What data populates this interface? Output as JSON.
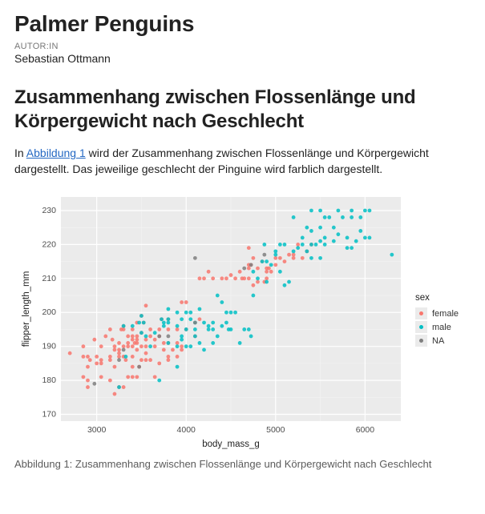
{
  "header": {
    "title": "Palmer Penguins",
    "author_label": "AUTOR:IN",
    "author_name": "Sebastian Ottmann"
  },
  "section": {
    "heading": "Zusammenhang zwischen Flossenlänge und Körpergewicht nach Geschlecht",
    "para_before": "In ",
    "figref": "Abbildung 1",
    "para_after": " wird der Zusammenhang zwischen Flossenlänge und Körpergewicht dargestellt. Das jeweilige geschlecht der Pinguine wird farblich dargestellt."
  },
  "figure": {
    "caption": "Abbildung 1: Zusammenhang zwischen Flossenlänge und Körpergewicht nach Geschlecht"
  },
  "colors": {
    "female": "#f8766d",
    "male": "#00bfc4",
    "na": "#7f7f7f",
    "panel": "#ebebeb"
  },
  "legend": {
    "title": "sex",
    "items": [
      {
        "label": "female",
        "color_key": "female"
      },
      {
        "label": "male",
        "color_key": "male"
      },
      {
        "label": "NA",
        "color_key": "na"
      }
    ]
  },
  "chart_data": {
    "type": "scatter",
    "xlabel": "body_mass_g",
    "ylabel": "flipper_length_mm",
    "xlim": [
      2600,
      6400
    ],
    "ylim": [
      168,
      234
    ],
    "x_ticks": [
      3000,
      4000,
      5000,
      6000
    ],
    "y_ticks": [
      170,
      180,
      190,
      200,
      210,
      220,
      230
    ],
    "series": [
      {
        "name": "female",
        "color_key": "female",
        "points": [
          [
            2700,
            188
          ],
          [
            2850,
            181
          ],
          [
            2850,
            187
          ],
          [
            2850,
            190
          ],
          [
            2900,
            178
          ],
          [
            2900,
            180
          ],
          [
            2900,
            184
          ],
          [
            2900,
            187
          ],
          [
            2925,
            186
          ],
          [
            2975,
            192
          ],
          [
            3000,
            185
          ],
          [
            3000,
            187
          ],
          [
            3050,
            181
          ],
          [
            3050,
            185
          ],
          [
            3050,
            186
          ],
          [
            3050,
            190
          ],
          [
            3100,
            193
          ],
          [
            3150,
            180
          ],
          [
            3150,
            186
          ],
          [
            3150,
            187
          ],
          [
            3150,
            195
          ],
          [
            3175,
            192
          ],
          [
            3200,
            176
          ],
          [
            3200,
            184
          ],
          [
            3200,
            189
          ],
          [
            3200,
            190
          ],
          [
            3250,
            178
          ],
          [
            3250,
            187
          ],
          [
            3250,
            188
          ],
          [
            3250,
            189
          ],
          [
            3250,
            191
          ],
          [
            3275,
            195
          ],
          [
            3300,
            178
          ],
          [
            3300,
            187
          ],
          [
            3300,
            190
          ],
          [
            3300,
            195
          ],
          [
            3300,
            196
          ],
          [
            3325,
            186
          ],
          [
            3350,
            181
          ],
          [
            3350,
            190
          ],
          [
            3350,
            191
          ],
          [
            3350,
            193
          ],
          [
            3400,
            181
          ],
          [
            3400,
            184
          ],
          [
            3400,
            187
          ],
          [
            3400,
            190
          ],
          [
            3400,
            192
          ],
          [
            3400,
            193
          ],
          [
            3400,
            195
          ],
          [
            3425,
            191
          ],
          [
            3450,
            181
          ],
          [
            3450,
            189
          ],
          [
            3450,
            191
          ],
          [
            3450,
            192
          ],
          [
            3450,
            193
          ],
          [
            3450,
            197
          ],
          [
            3475,
            184
          ],
          [
            3500,
            186
          ],
          [
            3500,
            190
          ],
          [
            3500,
            194
          ],
          [
            3500,
            199
          ],
          [
            3525,
            197
          ],
          [
            3550,
            186
          ],
          [
            3550,
            188
          ],
          [
            3550,
            190
          ],
          [
            3550,
            192
          ],
          [
            3550,
            202
          ],
          [
            3600,
            186
          ],
          [
            3600,
            193
          ],
          [
            3600,
            195
          ],
          [
            3650,
            181
          ],
          [
            3650,
            190
          ],
          [
            3650,
            192
          ],
          [
            3700,
            185
          ],
          [
            3700,
            193
          ],
          [
            3700,
            195
          ],
          [
            3725,
            198
          ],
          [
            3750,
            189
          ],
          [
            3750,
            191
          ],
          [
            3800,
            186
          ],
          [
            3800,
            187
          ],
          [
            3800,
            191
          ],
          [
            3800,
            195
          ],
          [
            3800,
            198
          ],
          [
            3850,
            189
          ],
          [
            3900,
            187
          ],
          [
            3900,
            191
          ],
          [
            3900,
            195
          ],
          [
            3950,
            189
          ],
          [
            3950,
            190
          ],
          [
            4000,
            195
          ],
          [
            4000,
            203
          ],
          [
            4100,
            193
          ],
          [
            4150,
            210
          ],
          [
            4150,
            198
          ],
          [
            3950,
            203
          ],
          [
            4200,
            210
          ],
          [
            4250,
            212
          ],
          [
            4300,
            210
          ],
          [
            4400,
            210
          ],
          [
            4450,
            210
          ],
          [
            4500,
            211
          ],
          [
            4550,
            210
          ],
          [
            4600,
            212
          ],
          [
            4625,
            210
          ],
          [
            4650,
            210
          ],
          [
            4700,
            210
          ],
          [
            4700,
            213
          ],
          [
            4700,
            214
          ],
          [
            4700,
            219
          ],
          [
            4725,
            214
          ],
          [
            4750,
            208
          ],
          [
            4750,
            216
          ],
          [
            4800,
            209
          ],
          [
            4800,
            213
          ],
          [
            4850,
            215
          ],
          [
            4875,
            209
          ],
          [
            4900,
            210
          ],
          [
            4900,
            212
          ],
          [
            4900,
            213
          ],
          [
            4925,
            213
          ],
          [
            4950,
            212
          ],
          [
            5000,
            214
          ],
          [
            5000,
            216
          ],
          [
            5050,
            216
          ],
          [
            5100,
            215
          ],
          [
            5150,
            217
          ],
          [
            5200,
            216
          ],
          [
            5200,
            217
          ],
          [
            5250,
            220
          ],
          [
            5300,
            216
          ],
          [
            5350,
            218
          ],
          [
            5400,
            220
          ]
        ]
      },
      {
        "name": "male",
        "color_key": "male",
        "points": [
          [
            3250,
            178
          ],
          [
            3300,
            196
          ],
          [
            3325,
            187
          ],
          [
            3400,
            196
          ],
          [
            3475,
            197
          ],
          [
            3500,
            194
          ],
          [
            3500,
            199
          ],
          [
            3525,
            197
          ],
          [
            3550,
            193
          ],
          [
            3600,
            190
          ],
          [
            3650,
            194
          ],
          [
            3700,
            180
          ],
          [
            3725,
            198
          ],
          [
            3750,
            196
          ],
          [
            3750,
            197
          ],
          [
            3800,
            191
          ],
          [
            3800,
            197
          ],
          [
            3800,
            198
          ],
          [
            3800,
            201
          ],
          [
            3900,
            184
          ],
          [
            3900,
            190
          ],
          [
            3900,
            196
          ],
          [
            3900,
            200
          ],
          [
            3950,
            192
          ],
          [
            3950,
            193
          ],
          [
            3950,
            198
          ],
          [
            4000,
            190
          ],
          [
            4000,
            195
          ],
          [
            4000,
            200
          ],
          [
            4050,
            190
          ],
          [
            4050,
            198
          ],
          [
            4050,
            200
          ],
          [
            4100,
            193
          ],
          [
            4100,
            195
          ],
          [
            4100,
            197
          ],
          [
            4150,
            191
          ],
          [
            4150,
            201
          ],
          [
            4200,
            189
          ],
          [
            4200,
            197
          ],
          [
            4250,
            195
          ],
          [
            4250,
            196
          ],
          [
            4300,
            191
          ],
          [
            4300,
            195
          ],
          [
            4300,
            197
          ],
          [
            4350,
            193
          ],
          [
            4350,
            205
          ],
          [
            4400,
            196
          ],
          [
            4400,
            203
          ],
          [
            4450,
            197
          ],
          [
            4450,
            200
          ],
          [
            4475,
            195
          ],
          [
            4500,
            195
          ],
          [
            4500,
            200
          ],
          [
            4550,
            200
          ],
          [
            4600,
            191
          ],
          [
            4650,
            195
          ],
          [
            4700,
            195
          ],
          [
            4725,
            193
          ],
          [
            4750,
            205
          ],
          [
            4800,
            210
          ],
          [
            4750,
            212
          ],
          [
            4850,
            215
          ],
          [
            4875,
            220
          ],
          [
            4900,
            209
          ],
          [
            4900,
            215
          ],
          [
            4950,
            214
          ],
          [
            5000,
            217
          ],
          [
            5000,
            218
          ],
          [
            5050,
            212
          ],
          [
            5050,
            220
          ],
          [
            5100,
            208
          ],
          [
            5100,
            220
          ],
          [
            5150,
            209
          ],
          [
            5200,
            218
          ],
          [
            5200,
            228
          ],
          [
            5250,
            219
          ],
          [
            5300,
            220
          ],
          [
            5300,
            222
          ],
          [
            5350,
            218
          ],
          [
            5350,
            225
          ],
          [
            5400,
            216
          ],
          [
            5400,
            220
          ],
          [
            5400,
            224
          ],
          [
            5400,
            230
          ],
          [
            5450,
            220
          ],
          [
            5500,
            216
          ],
          [
            5500,
            221
          ],
          [
            5500,
            225
          ],
          [
            5500,
            230
          ],
          [
            5550,
            220
          ],
          [
            5550,
            222
          ],
          [
            5550,
            228
          ],
          [
            5600,
            228
          ],
          [
            5650,
            221
          ],
          [
            5650,
            225
          ],
          [
            5700,
            223
          ],
          [
            5700,
            230
          ],
          [
            5750,
            228
          ],
          [
            5800,
            219
          ],
          [
            5800,
            222
          ],
          [
            5850,
            219
          ],
          [
            5850,
            228
          ],
          [
            5850,
            230
          ],
          [
            5900,
            221
          ],
          [
            5950,
            224
          ],
          [
            5950,
            228
          ],
          [
            6000,
            222
          ],
          [
            6000,
            230
          ],
          [
            6050,
            222
          ],
          [
            6050,
            230
          ],
          [
            6300,
            217
          ]
        ]
      },
      {
        "name": "NA",
        "color_key": "na",
        "points": [
          [
            2975,
            179
          ],
          [
            3250,
            186
          ],
          [
            3300,
            189
          ],
          [
            3475,
            184
          ],
          [
            3700,
            193
          ],
          [
            3800,
            193
          ],
          [
            4100,
            216
          ],
          [
            4650,
            213
          ],
          [
            4725,
            214
          ],
          [
            4875,
            217
          ],
          [
            4100,
            197
          ]
        ]
      }
    ]
  }
}
